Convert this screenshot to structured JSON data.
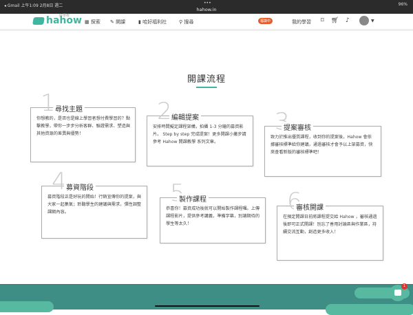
{
  "status_bar": {
    "left": "◂ Gmail  上午1:09  2月8日 週二",
    "dots": "•••",
    "url": "hahow.in",
    "right": "96%"
  },
  "nav": {
    "logo": "hahow",
    "logo_small": "好學校",
    "items": [
      "探索",
      "開課",
      "哈好福利社",
      "搜尋"
    ],
    "badge_text": "福袋中",
    "my_learning": "我的學習"
  },
  "page": {
    "title": "開課流程"
  },
  "steps": [
    {
      "num": "1",
      "title": "尋找主題",
      "text": "你想教的，是否也是線上學習者想付費學習的？點擊教學，帶你一步步分析客群、驗證需求、塑造與其他資源的差異與優勢！"
    },
    {
      "num": "2",
      "title": "編輯提案",
      "text": "安排時間擬定課程架構，拍攝 1-3 分鐘的募資影片。 Step by step 完成提案！更多開課小撇步請參考 Hahow 開課教學 系列文章。"
    },
    {
      "num": "3",
      "title": "提案審核",
      "text": "致力於推出優質課程，收到你的提案後，Hahow 會依據審核標準給你建議，通過審核才會予以上架募資，快來查看新版的審核標準吧！"
    },
    {
      "num": "4",
      "title": "募資階段",
      "text": "募資階段正是好玩的開始！行銷宣傳你的提案，與大家一起集氣；聆聽學生的建議與需求，彈性調整課綱內容。"
    },
    {
      "num": "5",
      "title": "製作課程",
      "text": "恭喜你！募資成功後就可以開始製作課程囉。上傳課程影片，提供參考講義，準備字幕，別讓期待的學生等太久！"
    },
    {
      "num": "6",
      "title": "審核開課",
      "text": "在預定開課日前將課程提交給 Hahow ，審核通過後即可正式開課！別忘了善用討論區與作業區，持續交流互動，創造更多收入！"
    }
  ],
  "chat": {
    "badge": "1"
  }
}
